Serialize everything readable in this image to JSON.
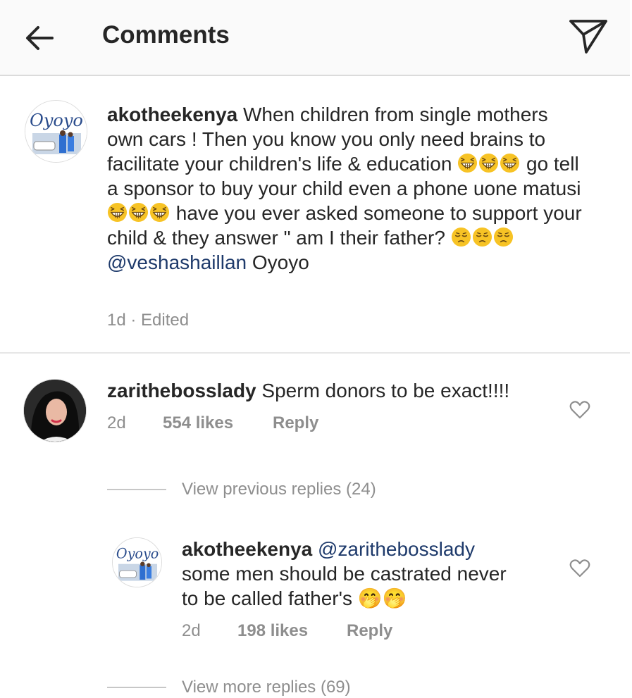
{
  "header": {
    "title": "Comments",
    "back_icon": "arrow-left-icon",
    "share_icon": "paper-plane-icon"
  },
  "caption": {
    "username": "akotheekenya",
    "segments": [
      " When  children from single mothers own cars ! Then you know you only need brains to facilitate your children's life & education ",
      " go tell a sponsor to buy your child even a phone uone matusi ",
      " have you ever asked someone to support your child & they answer \" am I their father? "
    ],
    "emoji_1": "grinning-squint-face",
    "emoji_2": "pensive-face",
    "mention": "@veshashaillan",
    "tail": " Oyoyo",
    "meta": "1d · Edited",
    "avatar_text": "Oyoyo"
  },
  "comment": {
    "username": "zarithebosslady",
    "text": " Sperm donors to be exact!!!!",
    "time": "2d",
    "likes": "554 likes",
    "reply": "Reply"
  },
  "view_previous": "View previous replies (24)",
  "reply": {
    "username": "akotheekenya",
    "mention": "@zarithebosslady",
    "text_line2": "some men should be castrated never",
    "text_line3": "to be called father's 🤭🤭",
    "time": "2d",
    "likes": "198 likes",
    "reply": "Reply"
  },
  "view_more": "View more replies (69)",
  "colors": {
    "text": "#262626",
    "secondary": "#8e8e8e",
    "mention": "#1e3a6b",
    "emoji_yellow": "#f7c325"
  }
}
